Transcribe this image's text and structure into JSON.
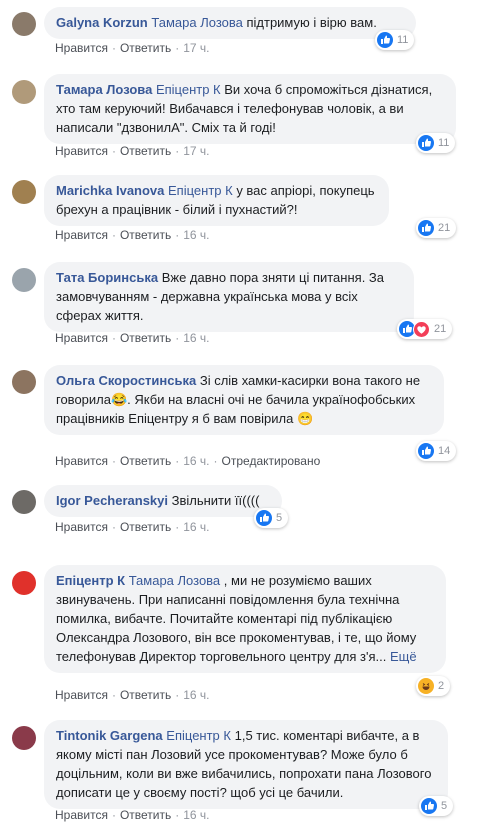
{
  "comments": [
    {
      "author": "Galyna Korzun",
      "mention": "Тамара Лозова",
      "text": " підтримую і вірю вам.",
      "like": "Нравится",
      "reply": "Ответить",
      "time": "17 ч.",
      "reaction_count": "11",
      "reactions": [
        "like"
      ],
      "avatar_color": "#8a7a6a"
    },
    {
      "author": "Тамара Лозова",
      "mention": "Епіцентр К",
      "text": " Ви хоча б спроможіться дізнатися, хто там керуючий! Вибачався і телефонував чоловік, а ви написали \"дзвонилА\". Сміх та й годі!",
      "like": "Нравится",
      "reply": "Ответить",
      "time": "17 ч.",
      "reaction_count": "11",
      "reactions": [
        "like"
      ],
      "avatar_color": "#b09a7a"
    },
    {
      "author": "Marichka Ivanova",
      "mention": "Епіцентр К",
      "text": " у вас апріорі, покупець брехун а працівник - білий і пухнастий?!",
      "like": "Нравится",
      "reply": "Ответить",
      "time": "16 ч.",
      "reaction_count": "21",
      "reactions": [
        "like"
      ],
      "avatar_color": "#a08050"
    },
    {
      "author": "Тата Боринська",
      "mention": "",
      "text": " Вже давно пора зняти ці питання. За замовчуванням - державна українська мова у всіх сферах життя.",
      "like": "Нравится",
      "reply": "Ответить",
      "time": "16 ч.",
      "reaction_count": "21",
      "reactions": [
        "like",
        "love"
      ],
      "avatar_color": "#9aa4ac"
    },
    {
      "author": "Ольга Скоростинська",
      "mention": "",
      "text": " Зі слів хамки-касирки вона такого не говорила😂. Якби на власні очі не бачила українофобських працівників Епіцентру я б вам повірила 😁",
      "like": "Нравится",
      "reply": "Ответить",
      "time": "16 ч.",
      "edited": "Отредактировано",
      "reaction_count": "14",
      "reactions": [
        "like"
      ],
      "avatar_color": "#8c7460"
    },
    {
      "author": "Igor Pecheranskyi",
      "mention": "",
      "text": " Звільнити її((((",
      "like": "Нравится",
      "reply": "Ответить",
      "time": "16 ч.",
      "reaction_count": "5",
      "reactions": [
        "like"
      ],
      "avatar_color": "#6d6a66"
    },
    {
      "author": "Епіцентр К",
      "mention": "Тамара Лозова",
      "text": " , ми не розуміємо ваших звинувачень. При написанні повідомлення була технічна помилка, вибачте. Почитайте коментарі під публікацією Олександра Лозового, він все прокоментував, і те, що йому телефонував Директор торговельного центру для з'я...",
      "more": "Ещё",
      "like": "Нравится",
      "reply": "Ответить",
      "time": "16 ч.",
      "reaction_count": "2",
      "reactions": [
        "haha"
      ],
      "avatar_color": "#e0312b"
    },
    {
      "author": "Tintonik Gargena",
      "mention": "Епіцентр К",
      "text": " 1,5 тис. коментарі вибачте, а в якому місті пан Лозовий усе прокоментував? Може було б доцільним, коли ви вже вибачились, попрохати пана Лозового дописати це у своєму пості? щоб усі це бачили.",
      "like": "Нравится",
      "reply": "Ответить",
      "time": "16 ч.",
      "reaction_count": "5",
      "reactions": [
        "like"
      ],
      "avatar_color": "#8a3a4a"
    }
  ]
}
